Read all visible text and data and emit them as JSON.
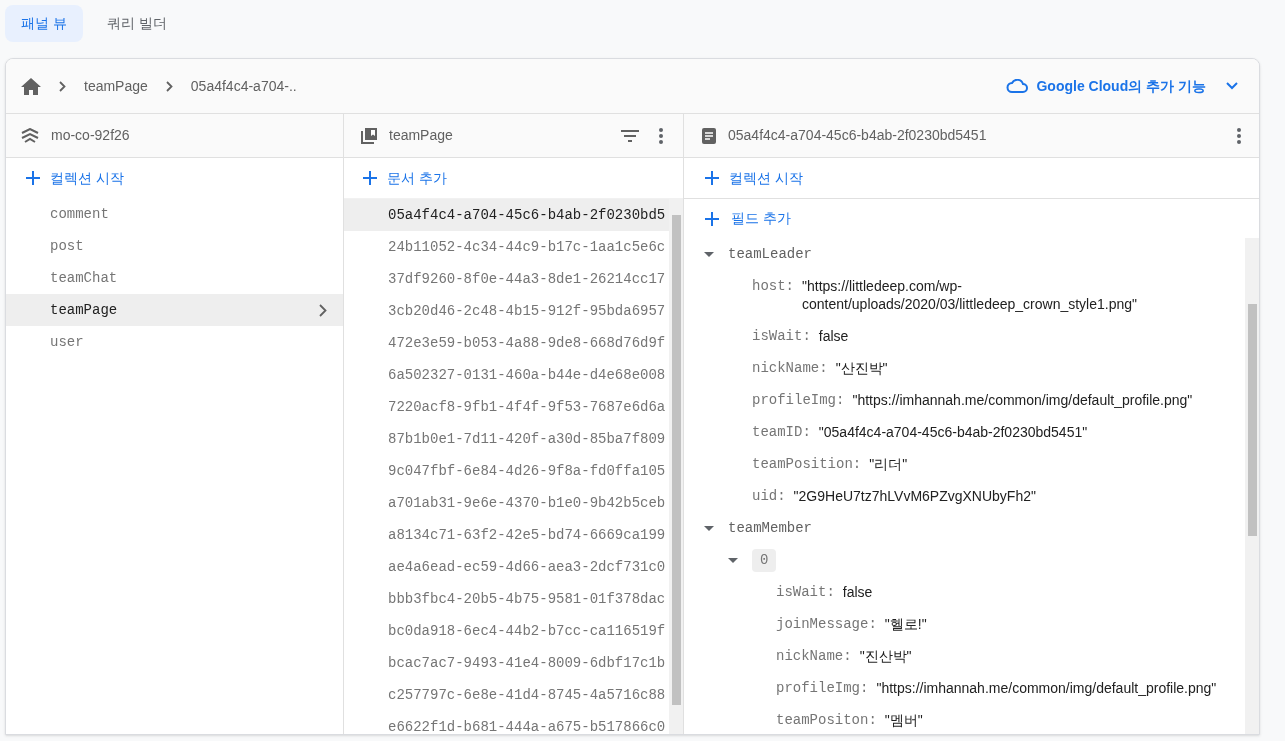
{
  "view_tabs": [
    {
      "label": "패널 뷰",
      "selected": true
    },
    {
      "label": "쿼리 빌더",
      "selected": false
    }
  ],
  "breadcrumb": [
    "teamPage",
    "05a4f4c4-a704-.."
  ],
  "cloud_link": "Google Cloud의 추가 기능",
  "root_column": {
    "title": "mo-co-92f26",
    "add_label": "컬렉션 시작",
    "items": [
      {
        "label": "comment",
        "selected": false
      },
      {
        "label": "post",
        "selected": false
      },
      {
        "label": "teamChat",
        "selected": false
      },
      {
        "label": "teamPage",
        "selected": true
      },
      {
        "label": "user",
        "selected": false
      }
    ]
  },
  "collection_column": {
    "title": "teamPage",
    "add_label": "문서 추가",
    "documents": [
      {
        "label": "05a4f4c4-a704-45c6-b4ab-2f0230bd5",
        "selected": true
      },
      {
        "label": "24b11052-4c34-44c9-b17c-1aa1c5e6c",
        "selected": false
      },
      {
        "label": "37df9260-8f0e-44a3-8de1-26214cc17",
        "selected": false
      },
      {
        "label": "3cb20d46-2c48-4b15-912f-95bda6957",
        "selected": false
      },
      {
        "label": "472e3e59-b053-4a88-9de8-668d76d9f",
        "selected": false
      },
      {
        "label": "6a502327-0131-460a-b44e-d4e68e008",
        "selected": false
      },
      {
        "label": "7220acf8-9fb1-4f4f-9f53-7687e6d6a",
        "selected": false
      },
      {
        "label": "87b1b0e1-7d11-420f-a30d-85ba7f809",
        "selected": false
      },
      {
        "label": "9c047fbf-6e84-4d26-9f8a-fd0ffa105",
        "selected": false
      },
      {
        "label": "a701ab31-9e6e-4370-b1e0-9b42b5ceb",
        "selected": false
      },
      {
        "label": "a8134c71-63f2-42e5-bd74-6669ca199",
        "selected": false
      },
      {
        "label": "ae4a6ead-ec59-4d66-aea3-2dcf731c0",
        "selected": false
      },
      {
        "label": "bbb3fbc4-20b5-4b75-9581-01f378dac",
        "selected": false
      },
      {
        "label": "bc0da918-6ec4-44b2-b7cc-ca116519f",
        "selected": false
      },
      {
        "label": "bcac7ac7-9493-41e4-8009-6dbf17c1b",
        "selected": false
      },
      {
        "label": "c257797c-6e8e-41d4-8745-4a5716c88",
        "selected": false
      },
      {
        "label": "e6622f1d-b681-444a-a675-b517866c0",
        "selected": false
      }
    ]
  },
  "document_column": {
    "title": "05a4f4c4-a704-45c6-b4ab-2f0230bd5451",
    "add_collection_label": "컬렉션 시작",
    "add_field_label": "필드 추가",
    "fields": [
      {
        "kind": "map",
        "key": "teamLeader",
        "expanded": true,
        "children": [
          {
            "kind": "value",
            "key": "host:",
            "value": "\"https://littledeep.com/wp-content/uploads/2020/03/littledeep_crown_style1.png\""
          },
          {
            "kind": "value",
            "key": "isWait:",
            "value": "false"
          },
          {
            "kind": "value",
            "key": "nickName:",
            "value": "\"산진박\""
          },
          {
            "kind": "value",
            "key": "profileImg:",
            "value": "\"https://imhannah.me/common/img/default_profile.png\""
          },
          {
            "kind": "value",
            "key": "teamID:",
            "value": "\"05a4f4c4-a704-45c6-b4ab-2f0230bd5451\""
          },
          {
            "kind": "value",
            "key": "teamPosition:",
            "value": "\"리더\""
          },
          {
            "kind": "value",
            "key": "uid:",
            "value": "\"2G9HeU7tz7hLVvM6PZvgXNUbyFh2\""
          }
        ]
      },
      {
        "kind": "map",
        "key": "teamMember",
        "expanded": true,
        "children": [
          {
            "kind": "index",
            "key": "0",
            "expanded": true,
            "children": [
              {
                "kind": "value",
                "key": "isWait:",
                "value": "false"
              },
              {
                "kind": "value",
                "key": "joinMessage:",
                "value": "\"헬로!\""
              },
              {
                "kind": "value",
                "key": "nickName:",
                "value": "\"진산박\""
              },
              {
                "kind": "value",
                "key": "profileImg:",
                "value": "\"https://imhannah.me/common/img/default_profile.png\""
              },
              {
                "kind": "value",
                "key": "teamPositon:",
                "value": "\"멤버\""
              }
            ]
          }
        ]
      }
    ]
  }
}
